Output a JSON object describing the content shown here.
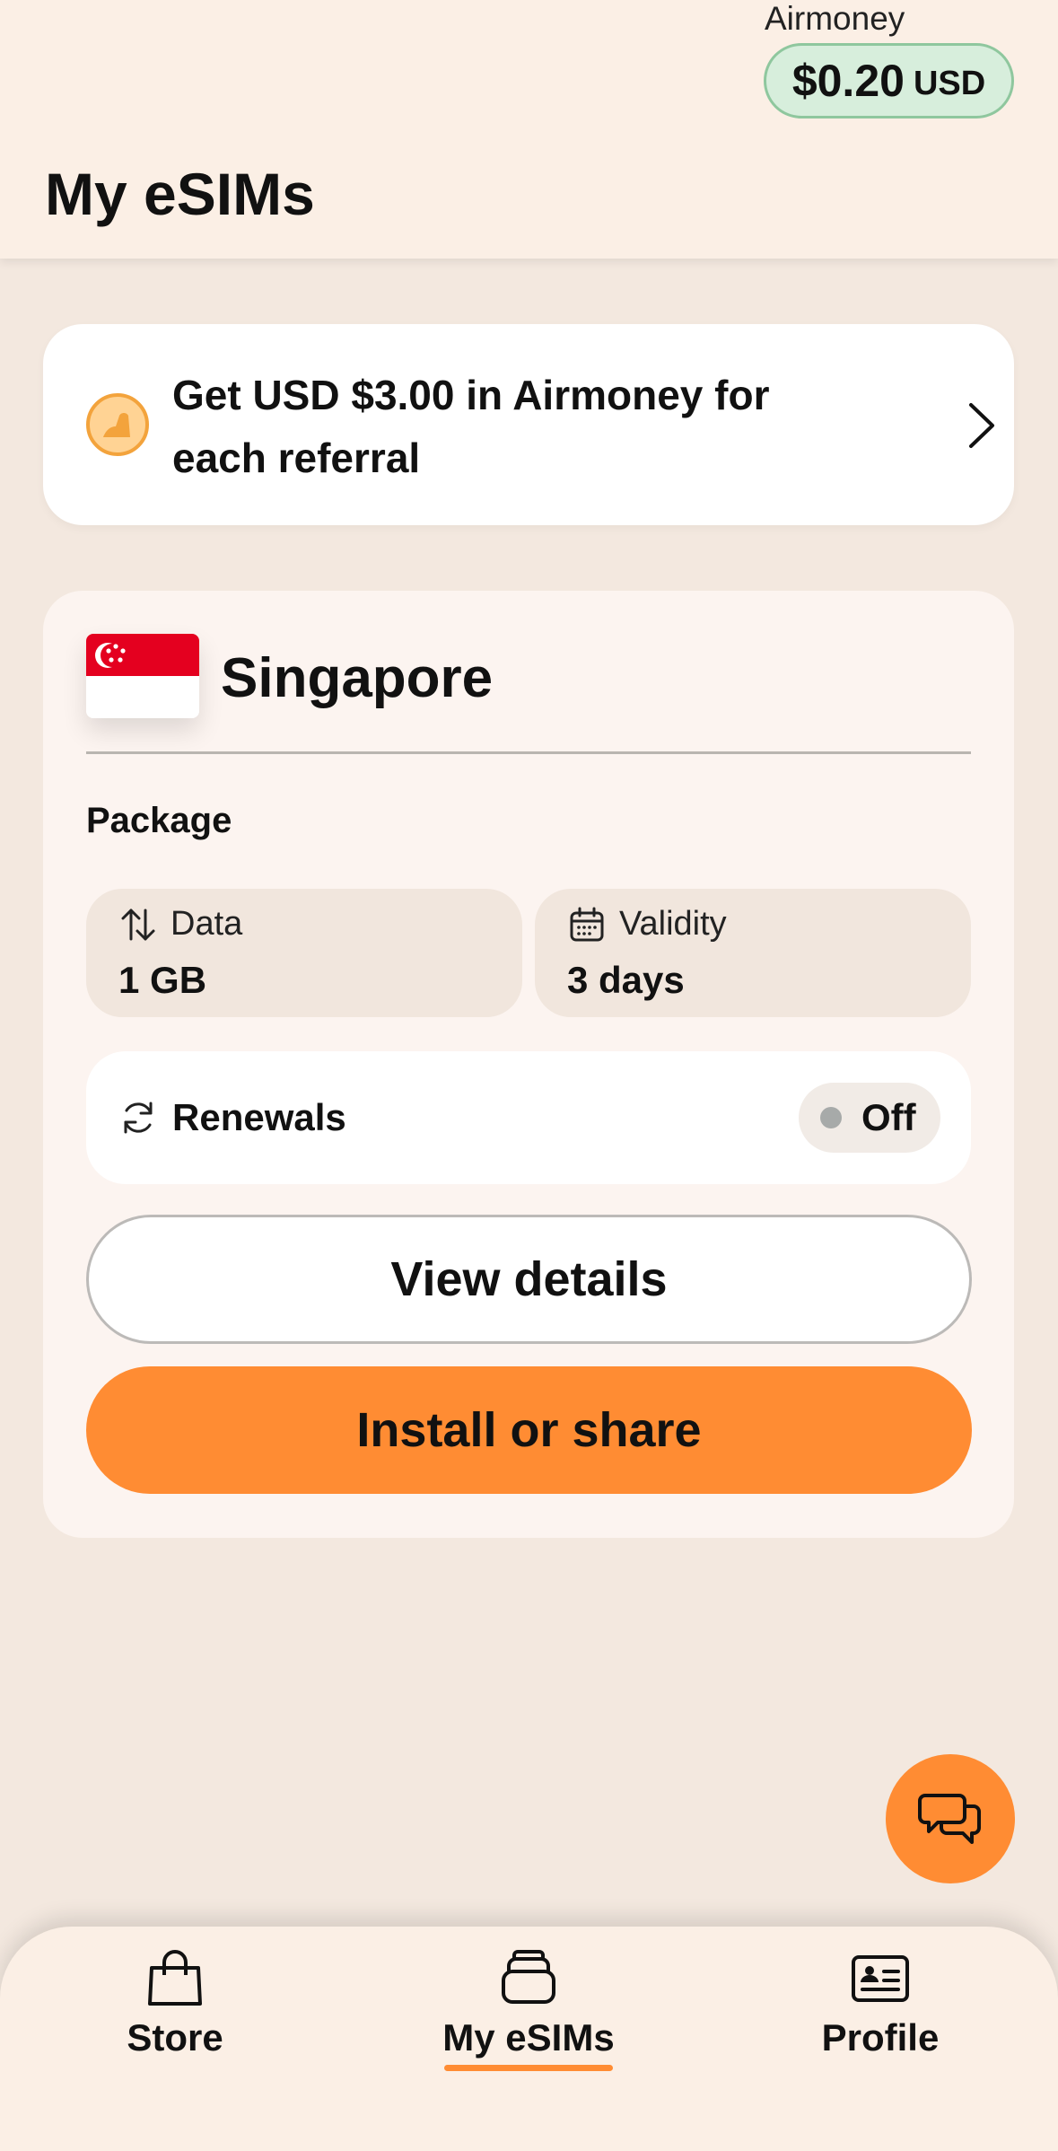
{
  "header": {
    "airmoney_label": "Airmoney",
    "balance_amount": "$0.20",
    "balance_currency": "USD",
    "title": "My eSIMs"
  },
  "referral": {
    "text": "Get USD $3.00 in Airmoney for each referral",
    "icon": "coin-icon"
  },
  "esim": {
    "country": "Singapore",
    "flag": "singapore-flag",
    "package_label": "Package",
    "data_label": "Data",
    "data_value": "1 GB",
    "validity_label": "Validity",
    "validity_value": "3 days",
    "renewals_label": "Renewals",
    "renewals_state": "Off",
    "view_details_label": "View details",
    "install_label": "Install or share"
  },
  "nav": {
    "items": [
      {
        "label": "Store",
        "icon": "shopping-bag-icon",
        "active": false
      },
      {
        "label": "My eSIMs",
        "icon": "sim-stack-icon",
        "active": true
      },
      {
        "label": "Profile",
        "icon": "id-card-icon",
        "active": false
      }
    ]
  },
  "colors": {
    "accent": "#ff8c33",
    "background": "#f3e8df",
    "header_bg": "#fbefe5",
    "balance_bg": "#d7eedc",
    "balance_border": "#8fc79e"
  }
}
